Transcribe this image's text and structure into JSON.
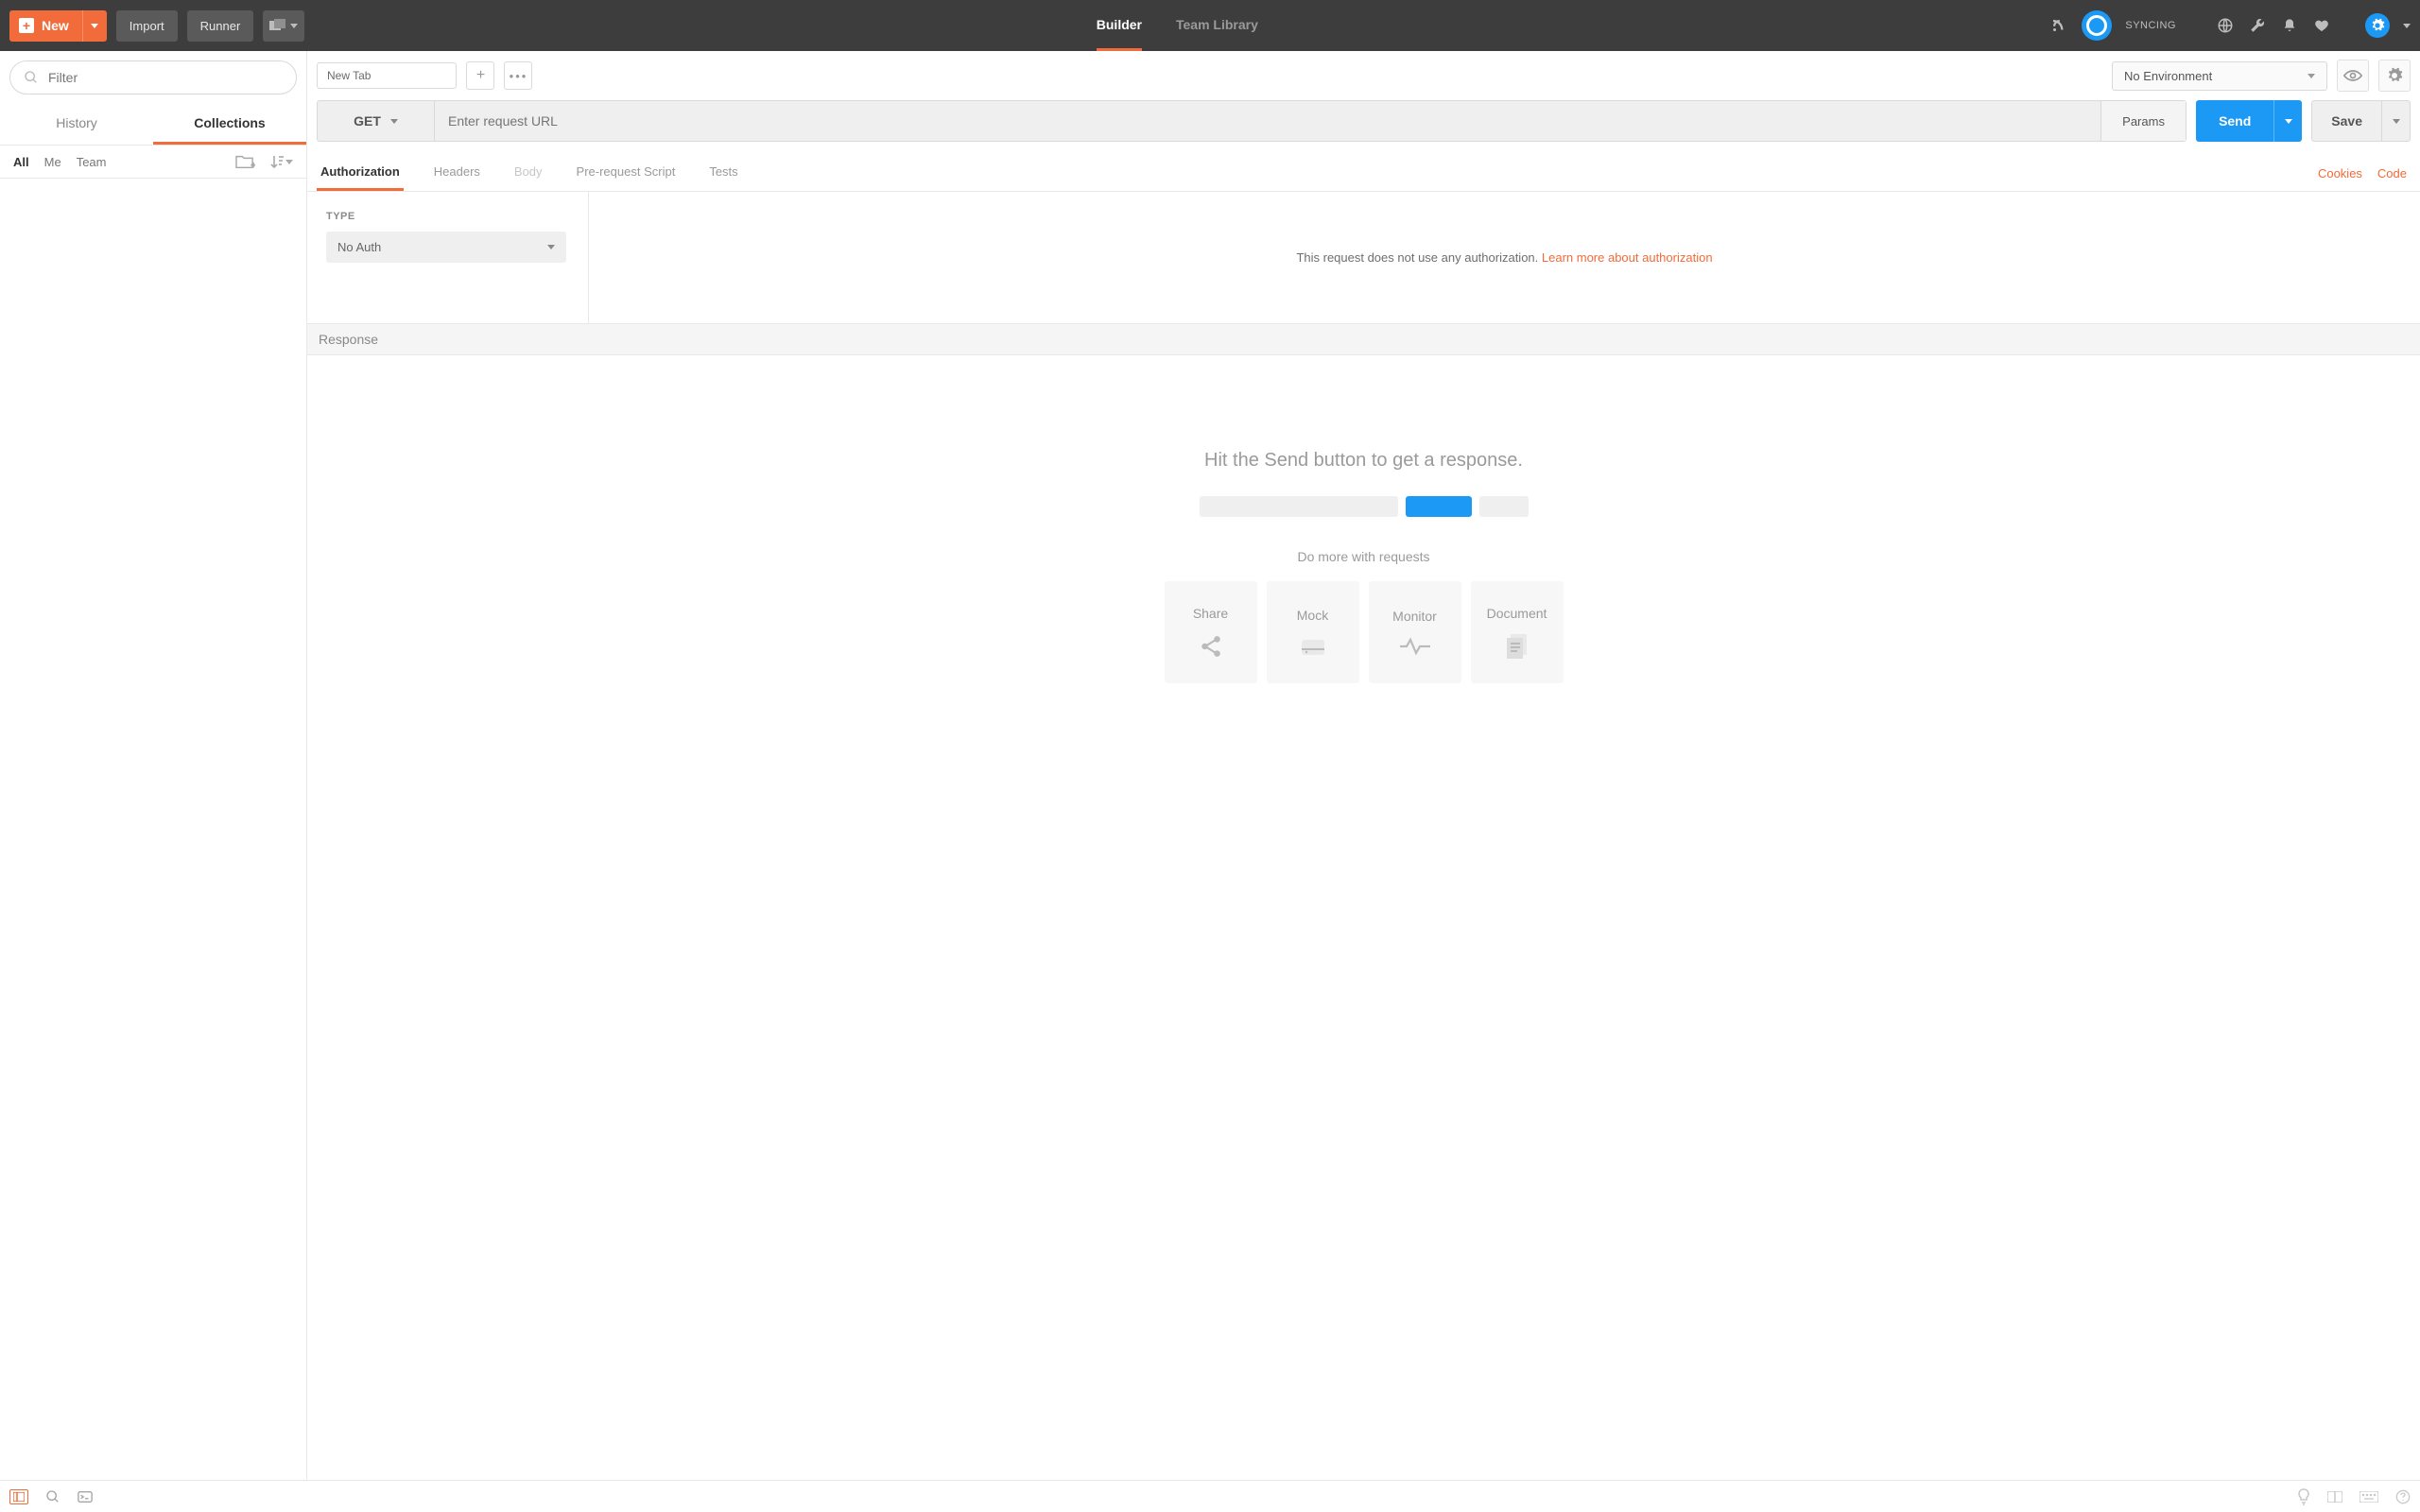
{
  "header": {
    "new_label": "New",
    "import_label": "Import",
    "runner_label": "Runner",
    "tab_builder": "Builder",
    "tab_team_library": "Team Library",
    "sync_status": "SYNCING"
  },
  "sidebar": {
    "filter_placeholder": "Filter",
    "tab_history": "History",
    "tab_collections": "Collections",
    "filters": {
      "all": "All",
      "me": "Me",
      "team": "Team"
    }
  },
  "request": {
    "tab_label": "New Tab",
    "method": "GET",
    "url_placeholder": "Enter request URL",
    "params_label": "Params",
    "send_label": "Send",
    "save_label": "Save",
    "env_selected": "No Environment",
    "subtabs": {
      "authorization": "Authorization",
      "headers": "Headers",
      "body": "Body",
      "prerequest": "Pre-request Script",
      "tests": "Tests"
    },
    "link_cookies": "Cookies",
    "link_code": "Code"
  },
  "auth": {
    "type_label": "TYPE",
    "selected": "No Auth",
    "info_text": "This request does not use any authorization. ",
    "info_link": "Learn more about authorization"
  },
  "response": {
    "heading": "Response",
    "prompt": "Hit the Send button to get a response.",
    "domore": "Do more with requests",
    "cards": {
      "share": "Share",
      "mock": "Mock",
      "monitor": "Monitor",
      "document": "Document"
    }
  }
}
